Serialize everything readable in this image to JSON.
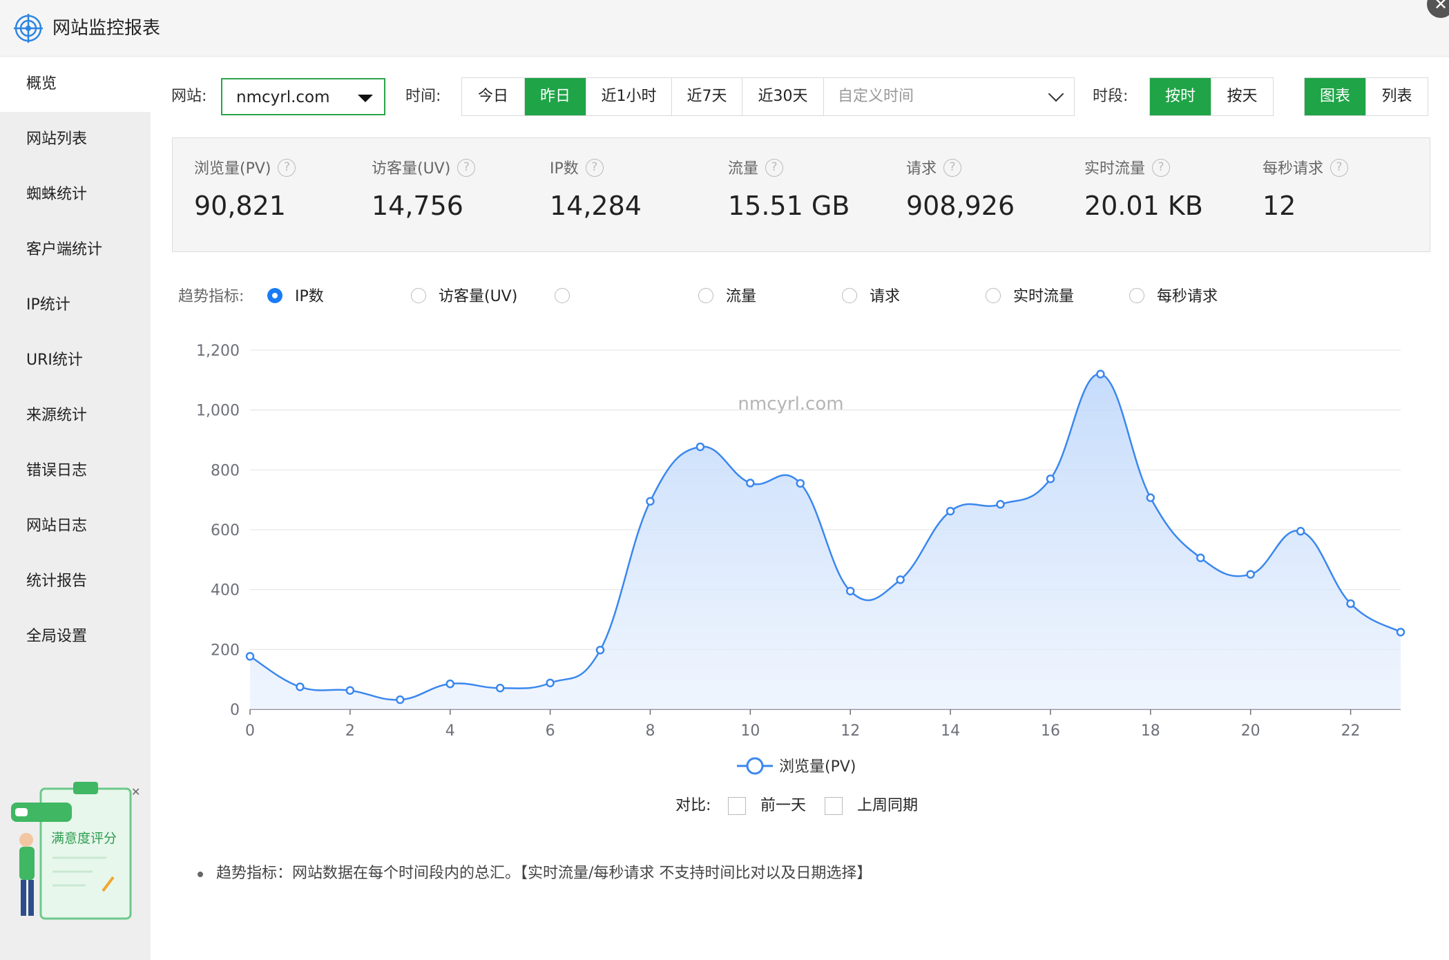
{
  "app": {
    "title": "网站监控报表"
  },
  "sidebar": {
    "items": [
      {
        "label": "概览",
        "active": true
      },
      {
        "label": "网站列表"
      },
      {
        "label": "蜘蛛统计"
      },
      {
        "label": "客户端统计"
      },
      {
        "label": "IP统计"
      },
      {
        "label": "URI统计"
      },
      {
        "label": "来源统计"
      },
      {
        "label": "错误日志"
      },
      {
        "label": "网站日志"
      },
      {
        "label": "统计报告"
      },
      {
        "label": "全局设置"
      }
    ],
    "widget_label": "满意度评分"
  },
  "filters": {
    "site_label": "网站:",
    "site_value": "nmcyrl.com",
    "time_label": "时间:",
    "time_options": [
      "今日",
      "昨日",
      "近1小时",
      "近7天",
      "近30天"
    ],
    "time_selected": "昨日",
    "custom_time_placeholder": "自定义时间",
    "period_label": "时段:",
    "period_options": [
      "按时",
      "按天"
    ],
    "period_selected": "按时",
    "view_options": [
      "图表",
      "列表"
    ],
    "view_selected": "图表"
  },
  "stats": [
    {
      "name": "浏览量(PV)",
      "value": "90,821"
    },
    {
      "name": "访客量(UV)",
      "value": "14,756"
    },
    {
      "name": "IP数",
      "value": "14,284"
    },
    {
      "name": "流量",
      "value": "15.51 GB"
    },
    {
      "name": "请求",
      "value": "908,926"
    },
    {
      "name": "实时流量",
      "value": "20.01 KB"
    },
    {
      "name": "每秒请求",
      "value": "12"
    }
  ],
  "trend": {
    "label": "趋势指标:",
    "options": [
      "IP数",
      "访客量(UV)",
      "",
      "流量",
      "请求",
      "实时流量",
      "每秒请求"
    ],
    "selected": "IP数"
  },
  "chart_data": {
    "type": "area",
    "watermark": "nmcyrl.com",
    "x": [
      0,
      1,
      2,
      3,
      4,
      5,
      6,
      7,
      8,
      9,
      10,
      11,
      12,
      13,
      14,
      15,
      16,
      17,
      18,
      19,
      20,
      21,
      22,
      23
    ],
    "x_ticks": [
      0,
      2,
      4,
      6,
      8,
      10,
      12,
      14,
      16,
      18,
      20,
      22
    ],
    "y_ticks": [
      "0",
      "200",
      "400",
      "600",
      "800",
      "1,000",
      "1,200"
    ],
    "ylim": [
      0,
      1200
    ],
    "series": [
      {
        "name": "浏览量(PV)",
        "color": "#3a87ee",
        "values": [
          177,
          75,
          63,
          32,
          85,
          71,
          88,
          198,
          695,
          877,
          756,
          755,
          395,
          433,
          662,
          685,
          770,
          1120,
          707,
          506,
          451,
          595,
          353,
          258
        ]
      }
    ],
    "legend_position": "bottom",
    "grid": true
  },
  "compare": {
    "label": "对比:",
    "options": [
      "前一天",
      "上周同期"
    ]
  },
  "note": "趋势指标：网站数据在每个时间段内的总汇。【实时流量/每秒请求 不支持时间比对以及日期选择】",
  "colors": {
    "accent": "#1fa447",
    "line": "#3a87ee",
    "radio": "#1a7cf5"
  }
}
